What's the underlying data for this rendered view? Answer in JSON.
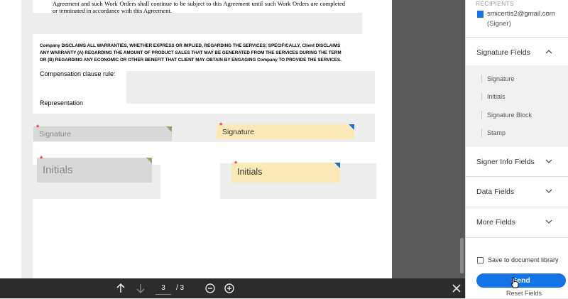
{
  "document": {
    "top_text": "Agreement and such Work Orders shall continue to be subject to this Agreement until such Work Orders are completed or terminated in accordance with this Agreement.",
    "disclaimer": "Company DISCLAIMS ALL WARRANTIES, WHETHER EXPRESS OR IMPLIED, REGARDING THE SERVICES; SPECIFICALLY, Client DISCLAIMS ANY WARRANTY (A) REGARDING THE AMOUNT OF PRODUCT SALES THAT MAY BE GENERATED FROM THE SERVICES DURING THE TERM OR (B) REGARDING ANY ECONOMIC OR OTHER BENEFIT THAT CLIENT MAY OBTAIN BY ENGAGING Company TO PROVIDE THE SERVICES.",
    "compensation_label": "Compensation clause rule:",
    "representation_label": "Representation",
    "fields": {
      "signature_grey": "Signature",
      "signature_yellow": "Signature",
      "initials_grey": "Initials",
      "initials_yellow": "Initials"
    },
    "required_mark": "*"
  },
  "toolbar": {
    "current_page": "3",
    "page_of": "/ 3"
  },
  "sidebar": {
    "recipients_header": "RECIPIENTS",
    "recipient_email": "smicertis2@gmail.com",
    "recipient_role": "(Signer)",
    "recipient_color": "#1473e6",
    "sections": {
      "signature_fields": "Signature Fields",
      "signer_info_fields": "Signer Info Fields",
      "data_fields": "Data Fields",
      "more_fields": "More Fields"
    },
    "signature_items": [
      "Signature",
      "Initials",
      "Signature Block",
      "Stamp"
    ],
    "save_library": "Save to document library",
    "send": "Send",
    "reset": "Reset Fields"
  },
  "colors": {
    "accent": "#1473e6",
    "field_yellow": "#fbeab7",
    "field_grey": "#d8d8d8",
    "required": "#e0403a"
  }
}
